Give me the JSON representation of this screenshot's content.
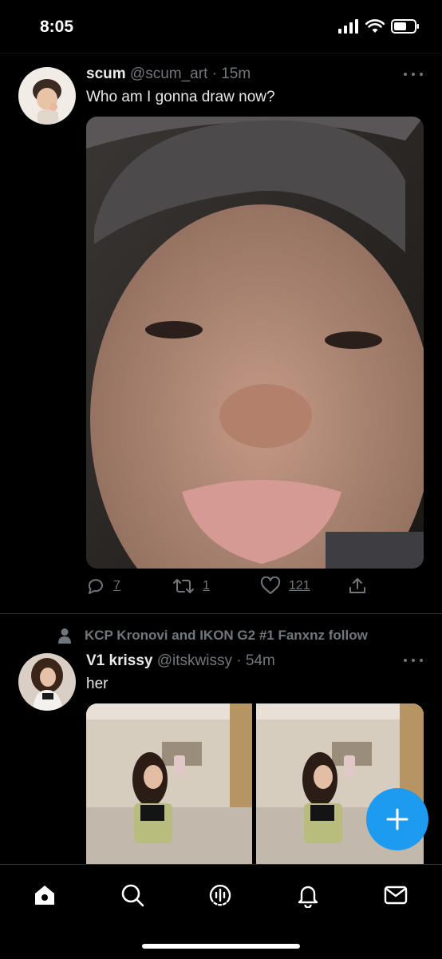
{
  "status_bar": {
    "time": "8:05"
  },
  "tweets": [
    {
      "name": "scum",
      "handle": "@scum_art",
      "separator": "·",
      "time": "15m",
      "text": "Who am I gonna draw now?",
      "actions": {
        "replies": "7",
        "retweets": "1",
        "likes": "121"
      }
    },
    {
      "social_context": "KCP Kronovi and IKON G2 #1 Fanxnz follow",
      "name": "V1 krissy",
      "handle": "@itskwissy",
      "separator": "·",
      "time": "54m",
      "text": "her"
    }
  ],
  "icons": {
    "reply": "reply-icon",
    "retweet": "retweet-icon",
    "like": "heart-icon",
    "share": "share-icon",
    "compose": "plus-icon",
    "home": "home-icon",
    "search": "search-icon",
    "spaces": "spaces-icon",
    "notifications": "bell-icon",
    "messages": "mail-icon"
  },
  "colors": {
    "accent": "#1d9bf0",
    "text": "#e7e9ea",
    "muted": "#71767b",
    "background": "#000000"
  }
}
